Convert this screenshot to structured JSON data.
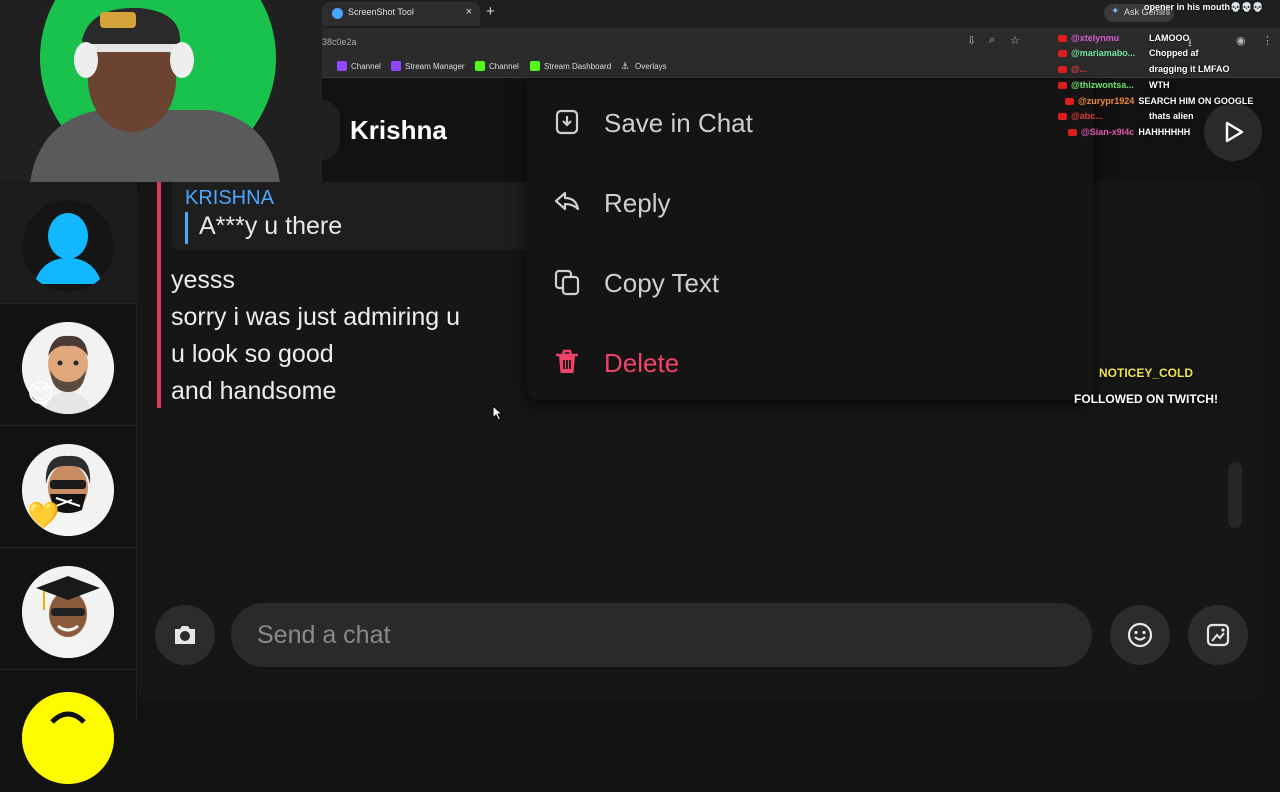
{
  "browser": {
    "tab_title": "ScreenShot Tool",
    "tab_close": "×",
    "new_tab": "+",
    "url": "38c0e2a",
    "gemini_label": "Ask Gemini",
    "bookmarks": [
      {
        "label": "Channel",
        "color": "#9146ff"
      },
      {
        "label": "Stream Manager",
        "color": "#9146ff"
      },
      {
        "label": "Channel",
        "color": "#53fc18"
      },
      {
        "label": "Stream Dashboard",
        "color": "#53fc18"
      },
      {
        "label": "Overlays",
        "color": "#dddddd"
      }
    ]
  },
  "header": {
    "chat_name": "Krishna"
  },
  "conversation": {
    "quoted_name": "KRISHNA",
    "quoted_text": "A***y u there",
    "messages": [
      "yesss",
      "sorry i was just admiring u",
      "u look so good",
      "and handsome"
    ]
  },
  "context_menu": {
    "items": [
      {
        "label": "Save in Chat",
        "icon": "save-icon"
      },
      {
        "label": "Reply",
        "icon": "reply-icon"
      },
      {
        "label": "Copy Text",
        "icon": "copy-icon"
      },
      {
        "label": "Delete",
        "icon": "trash-icon",
        "color": "#f0426b"
      }
    ]
  },
  "composer": {
    "placeholder": "Send a chat"
  },
  "sidebar": {
    "friends": [
      {
        "avatar": "default-avatar",
        "emoji": ""
      },
      {
        "avatar": "bitmoji-bearded",
        "emoji": "😊"
      },
      {
        "avatar": "bitmoji-masked",
        "emoji": "💛"
      },
      {
        "avatar": "bitmoji-graduate",
        "emoji": ""
      }
    ]
  },
  "stream_chat": [
    {
      "user": "opener in his mouth💀💀💀",
      "msg": "",
      "user_color": "#ffffff"
    },
    {
      "user": "@xtelynmu",
      "msg": "LAMOOO",
      "user_color": "#d65bd6"
    },
    {
      "user": "@mariamabo...",
      "msg": "Chopped af",
      "user_color": "#6ee0a0"
    },
    {
      "user": "@...",
      "msg": "dragging it LMFAO",
      "user_color": "#e03a3a"
    },
    {
      "user": "@thizwontsa...",
      "msg": "WTH",
      "user_color": "#6ee06e"
    },
    {
      "user": "@zurypr1924",
      "msg": "SEARCH HIM ON GOOGLE",
      "user_color": "#f08a3a"
    },
    {
      "user": "@abc...",
      "msg": "thats alien",
      "user_color": "#e03a3a"
    },
    {
      "user": "@Sian-x9l4c",
      "msg": "HAHHHHHH",
      "user_color": "#e05ab0"
    }
  ],
  "follow_alert": {
    "name": "NOTICEY_COLD",
    "text": "FOLLOWED ON TWITCH!"
  },
  "colors": {
    "accent_blue": "#4aa8ff",
    "message_bar": "#e0375a",
    "danger": "#f0426b"
  }
}
